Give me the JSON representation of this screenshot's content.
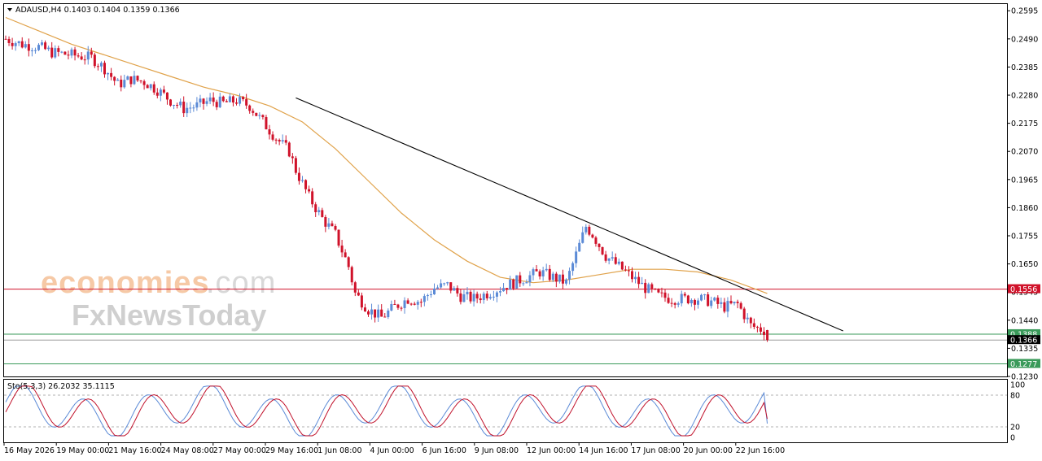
{
  "header": {
    "symbol_line": "ADAUSD,H4  0.1403 0.1404 0.1359 0.1366"
  },
  "watermark": {
    "brand_a": "economies",
    "brand_b": ".com",
    "brand_c": "FxNewsToday"
  },
  "colors": {
    "bull": "#5b8ad6",
    "bear": "#d0122a",
    "ma": "#e0a24a",
    "trend": "#000000",
    "resistance": "#d0122a",
    "support": "#3a9a5a",
    "stoch_main": "#5b8ad6",
    "stoch_signal": "#c0102a"
  },
  "chart_data": {
    "type": "candlestick",
    "symbol": "ADAUSD",
    "timeframe": "H4",
    "ohlc_last": {
      "open": 0.1403,
      "high": 0.1404,
      "low": 0.1359,
      "close": 0.1366
    },
    "ylim": [
      0.123,
      0.262
    ],
    "y_ticks": [
      "0.2595",
      "0.2490",
      "0.2385",
      "0.2280",
      "0.2175",
      "0.2070",
      "0.1965",
      "0.1860",
      "0.1755",
      "0.1650",
      "0.1545",
      "0.1440",
      "0.1335",
      "0.1230"
    ],
    "x_ticks": [
      "16 May 2026",
      "19 May 00:00",
      "21 May 16:00",
      "24 May 08:00",
      "27 May 00:00",
      "29 May 16:00",
      "1 Jun 08:00",
      "4 Jun 00:00",
      "6 Jun 16:00",
      "9 Jun 08:00",
      "12 Jun 00:00",
      "14 Jun 16:00",
      "17 Jun 08:00",
      "20 Jun 00:00",
      "22 Jun 16:00"
    ],
    "price_path": [
      [
        0,
        0.249
      ],
      [
        5,
        0.247
      ],
      [
        10,
        0.246
      ],
      [
        14,
        0.244
      ],
      [
        20,
        0.243
      ],
      [
        26,
        0.242
      ],
      [
        30,
        0.238
      ],
      [
        34,
        0.232
      ],
      [
        38,
        0.234
      ],
      [
        42,
        0.233
      ],
      [
        46,
        0.23
      ],
      [
        50,
        0.226
      ],
      [
        54,
        0.223
      ],
      [
        58,
        0.224
      ],
      [
        62,
        0.226
      ],
      [
        66,
        0.225
      ],
      [
        70,
        0.226
      ],
      [
        74,
        0.224
      ],
      [
        78,
        0.218
      ],
      [
        82,
        0.212
      ],
      [
        86,
        0.207
      ],
      [
        88,
        0.2
      ],
      [
        92,
        0.19
      ],
      [
        96,
        0.182
      ],
      [
        100,
        0.176
      ],
      [
        104,
        0.164
      ],
      [
        106,
        0.154
      ],
      [
        110,
        0.148
      ],
      [
        114,
        0.145
      ],
      [
        118,
        0.149
      ],
      [
        122,
        0.152
      ],
      [
        126,
        0.151
      ],
      [
        130,
        0.156
      ],
      [
        134,
        0.157
      ],
      [
        138,
        0.153
      ],
      [
        142,
        0.152
      ],
      [
        146,
        0.154
      ],
      [
        150,
        0.156
      ],
      [
        154,
        0.158
      ],
      [
        158,
        0.16
      ],
      [
        162,
        0.162
      ],
      [
        166,
        0.16
      ],
      [
        170,
        0.158
      ],
      [
        172,
        0.165
      ],
      [
        174,
        0.172
      ],
      [
        176,
        0.179
      ],
      [
        178,
        0.176
      ],
      [
        182,
        0.168
      ],
      [
        186,
        0.164
      ],
      [
        190,
        0.16
      ],
      [
        194,
        0.156
      ],
      [
        198,
        0.153
      ],
      [
        202,
        0.152
      ],
      [
        206,
        0.152
      ],
      [
        210,
        0.152
      ],
      [
        214,
        0.151
      ],
      [
        218,
        0.149
      ],
      [
        222,
        0.15
      ],
      [
        226,
        0.142
      ],
      [
        228,
        0.141
      ],
      [
        230,
        0.1403
      ],
      [
        231,
        0.1366
      ]
    ],
    "moving_average": [
      [
        0,
        0.257
      ],
      [
        10,
        0.252
      ],
      [
        20,
        0.247
      ],
      [
        30,
        0.243
      ],
      [
        40,
        0.239
      ],
      [
        50,
        0.235
      ],
      [
        60,
        0.231
      ],
      [
        70,
        0.228
      ],
      [
        80,
        0.224
      ],
      [
        90,
        0.218
      ],
      [
        100,
        0.208
      ],
      [
        110,
        0.196
      ],
      [
        120,
        0.184
      ],
      [
        130,
        0.174
      ],
      [
        140,
        0.166
      ],
      [
        150,
        0.16
      ],
      [
        160,
        0.158
      ],
      [
        170,
        0.159
      ],
      [
        180,
        0.161
      ],
      [
        190,
        0.163
      ],
      [
        200,
        0.163
      ],
      [
        210,
        0.162
      ],
      [
        220,
        0.159
      ],
      [
        231,
        0.154
      ]
    ],
    "trendline": [
      [
        88,
        0.227
      ],
      [
        254,
        0.14
      ]
    ],
    "levels": [
      {
        "label": "0.1556",
        "value": 0.1556,
        "kind": "resistance"
      },
      {
        "label": "0.1388",
        "value": 0.1388,
        "kind": "support"
      },
      {
        "label": "0.1366",
        "value": 0.1366,
        "kind": "price"
      },
      {
        "label": "0.1277",
        "value": 0.1277,
        "kind": "support"
      }
    ],
    "stochastic": {
      "label": "Sto(5,3,3) 26.2032 35.1115",
      "params": [
        5,
        3,
        3
      ],
      "main": 26.2032,
      "signal": 35.1115,
      "ylim": [
        0,
        100
      ],
      "y_ticks": [
        "100",
        "80",
        "20",
        "0"
      ],
      "levels": [
        80,
        20
      ]
    }
  }
}
